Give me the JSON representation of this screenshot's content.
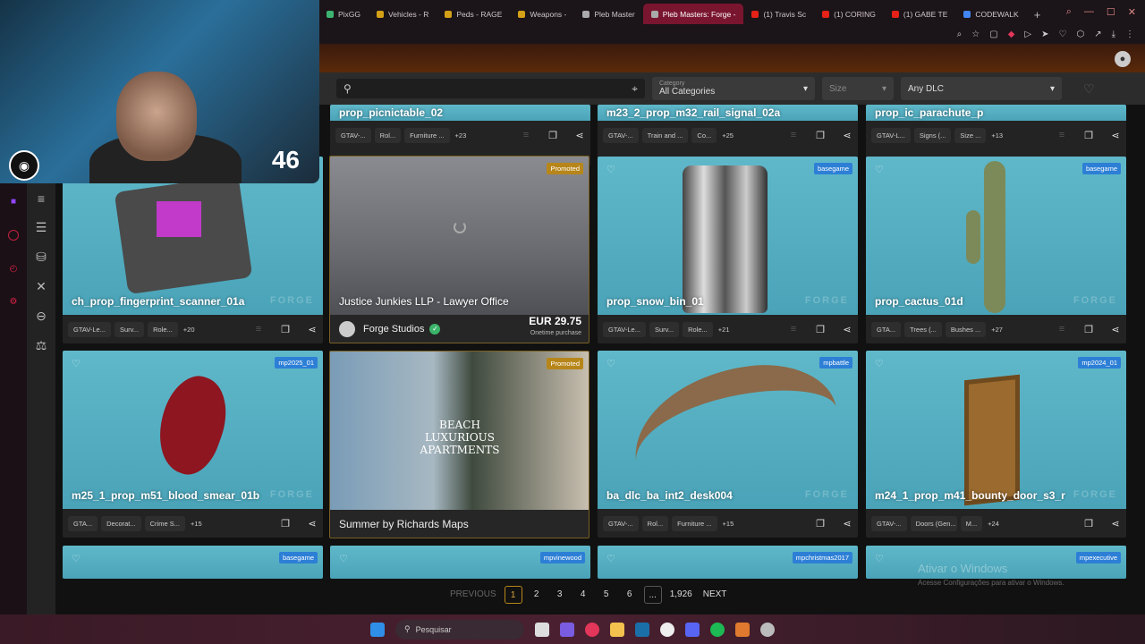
{
  "tabs": [
    {
      "label": "PixGG",
      "color": "#3cb371"
    },
    {
      "label": "Vehicles - R",
      "color": "#d4a017"
    },
    {
      "label": "Peds - RAGE",
      "color": "#d4a017"
    },
    {
      "label": "Weapons -",
      "color": "#d4a017"
    },
    {
      "label": "Pleb Master",
      "color": "#aaaaaa"
    },
    {
      "label": "Pleb Masters: Forge -",
      "color": "#aaaaaa",
      "active": true
    },
    {
      "label": "(1) Travis Sc",
      "color": "#e62117"
    },
    {
      "label": "(1) CORING",
      "color": "#e62117"
    },
    {
      "label": "(1) GABE TE",
      "color": "#e62117"
    },
    {
      "label": "CODEWALK",
      "color": "#4285f4"
    }
  ],
  "filters": {
    "search_placeholder": "",
    "category_label": "Category",
    "category_value": "All Categories",
    "size_value": "Size",
    "dlc_value": "Any DLC"
  },
  "cards_row0": [
    {
      "title": "prop_picnictable_02",
      "tags": [
        "GTAV-...",
        "Rol...",
        "Furniture ..."
      ],
      "more": "+23"
    },
    {
      "title": "m23_2_prop_m32_rail_signal_02a",
      "tags": [
        "GTAV-...",
        "Train and ...",
        "Co..."
      ],
      "more": "+25"
    },
    {
      "title": "prop_ic_parachute_p",
      "tags": [
        "GTAV-L...",
        "Signs (...",
        "Size ..."
      ],
      "more": "+13"
    }
  ],
  "cards_row1": [
    {
      "title": "ch_prop_fingerprint_scanner_01a",
      "badge": "",
      "tags": [
        "GTAV-Le...",
        "Surv...",
        "Role..."
      ],
      "more": "+20"
    },
    {
      "title": "prop_snow_bin_01",
      "badge": "basegame",
      "tags": [
        "GTAV-Le...",
        "Surv...",
        "Role..."
      ],
      "more": "+21"
    },
    {
      "title": "prop_cactus_01d",
      "badge": "basegame",
      "tags": [
        "GTA...",
        "Trees (...",
        "Bushes ..."
      ],
      "more": "+27"
    }
  ],
  "promo1": {
    "title": "Justice Junkies LLP - Lawyer Office",
    "badge": "Promoted",
    "seller": "Forge Studios",
    "price": "EUR 29.75",
    "price_note": "Onetime purchase"
  },
  "cards_row2": [
    {
      "title": "m25_1_prop_m51_blood_smear_01b",
      "badge": "mp2025_01",
      "tags": [
        "GTA...",
        "Decorat...",
        "Crime S..."
      ],
      "more": "+15"
    },
    {
      "title": "ba_dlc_ba_int2_desk004",
      "badge": "mpbattle",
      "tags": [
        "GTAV-...",
        "Rol...",
        "Furniture ..."
      ],
      "more": "+15"
    },
    {
      "title": "m24_1_prop_m41_bounty_door_s3_r",
      "badge": "mp2024_01",
      "tags": [
        "GTAV-...",
        "Doors (Gen...",
        "M..."
      ],
      "more": "+24"
    }
  ],
  "promo2": {
    "title": "Summer by Richards Maps",
    "badge": "Promoted",
    "image_text": "BEACH LUXURIOUS APARTMENTS"
  },
  "row3_badges": [
    "basegame",
    "mpvinewood",
    "mpchristmas2017",
    "mpexecutive"
  ],
  "watermark": "FORGE",
  "pagination": {
    "previous": "PREVIOUS",
    "pages": [
      "1",
      "2",
      "3",
      "4",
      "5",
      "6",
      "...",
      "1,926"
    ],
    "next": "NEXT",
    "current": "1"
  },
  "windows_activation": {
    "title": "Ativar o Windows",
    "subtitle": "Acesse Configurações para ativar o Windows."
  },
  "taskbar": {
    "search": "Pesquisar"
  },
  "webcam": {
    "viewer_count": "46"
  }
}
